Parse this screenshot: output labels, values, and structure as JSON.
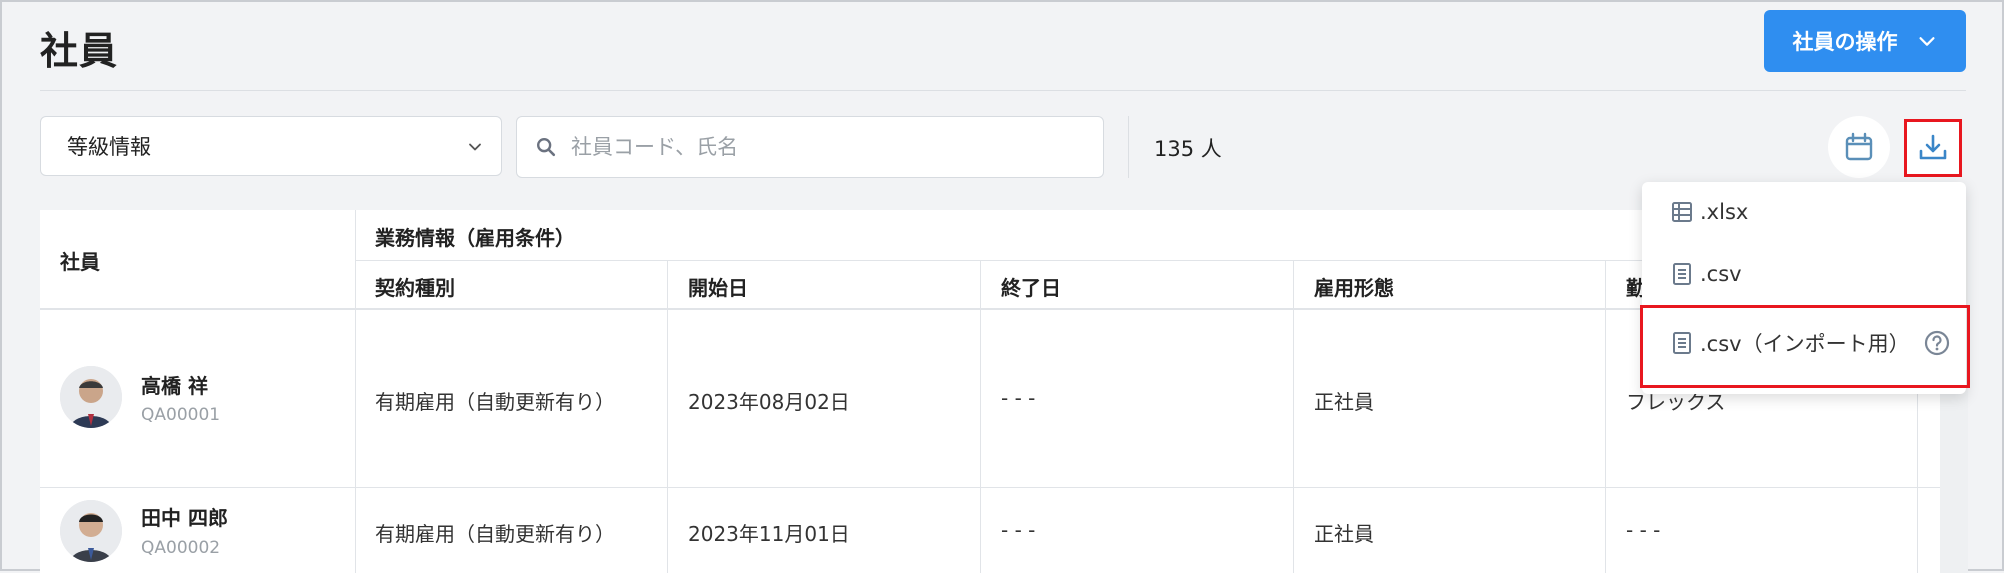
{
  "header": {
    "title": "社員",
    "actions_button": "社員の操作"
  },
  "filters": {
    "grade_select_value": "等級情報",
    "search_placeholder": "社員コード、氏名",
    "count": "135 人"
  },
  "export_menu": {
    "items": [
      {
        "label": ".xlsx",
        "icon": "spreadsheet-icon"
      },
      {
        "label": ".csv",
        "icon": "document-icon"
      },
      {
        "label": ".csv（インポート用）",
        "icon": "document-icon",
        "help_icon": "help-circle-icon"
      }
    ]
  },
  "table": {
    "employee_header": "社員",
    "group_header": "業務情報（雇用条件）",
    "columns": [
      "契約種別",
      "開始日",
      "終了日",
      "雇用形態",
      "勤"
    ],
    "rows": [
      {
        "name": "高橋 祥",
        "code": "QA00001",
        "contract_type": "有期雇用（自動更新有り）",
        "start_date": "2023年08月02日",
        "end_date": "- - -",
        "employment_type": "正社員",
        "work_style": "フレックス"
      },
      {
        "name": "田中 四郎",
        "code": "QA00002",
        "contract_type": "有期雇用（自動更新有り）",
        "start_date": "2023年11月01日",
        "end_date": "- - -",
        "employment_type": "正社員",
        "work_style": "- - -"
      }
    ]
  },
  "colors": {
    "primary": "#2f8ef0",
    "highlight": "#e8171f",
    "background": "#f2f3f5"
  }
}
